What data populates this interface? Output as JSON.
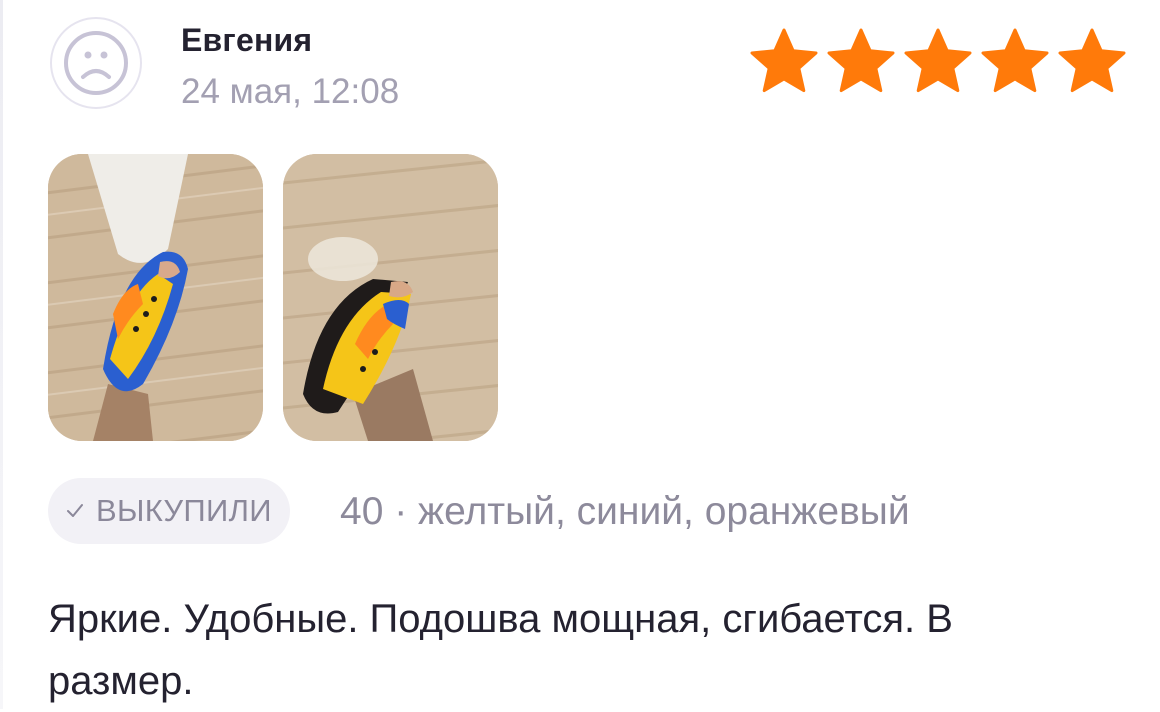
{
  "review": {
    "author": "Евгения",
    "date": "24 мая, 12:08",
    "rating": 5,
    "rating_max": 5,
    "star_color": "#ff7a0a",
    "photos": [
      {
        "name": "review-photo-1"
      },
      {
        "name": "review-photo-2"
      }
    ],
    "badge_label": "ВЫКУПИЛИ",
    "variant": "40 · желтый, синий, оранжевый",
    "text": "Яркие. Удобные. Подошва мощная, сгибается. В размер."
  },
  "icons": {
    "avatar": "user-placeholder-icon",
    "star": "star-icon",
    "check": "check-icon"
  }
}
